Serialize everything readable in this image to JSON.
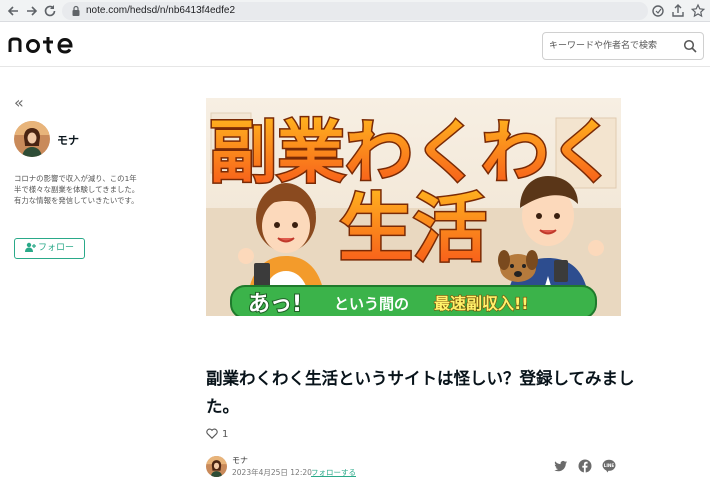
{
  "browser": {
    "url": "note.com/hedsd/n/nb6413f4edfe2",
    "icons": [
      "back-arrow-icon",
      "forward-arrow-icon",
      "reload-icon",
      "lock-icon",
      "cast-icon",
      "share-icon",
      "star-icon"
    ]
  },
  "header": {
    "logo": "note",
    "search_placeholder": "キーワードや作者名で検索"
  },
  "sidebar": {
    "collapse_label": "«",
    "author_name": "モナ",
    "bio": "コロナの影響で収入が減り、この1年半で様々な副業を体験してきました。有力な情報を発信していきたいです。",
    "follow_label": "フォロー"
  },
  "article": {
    "hero": {
      "headline_line1": "副業わくわく",
      "headline_line2": "生活",
      "banner_accent": "あっ!",
      "banner_mid": "という間の",
      "banner_strong": "最速副収入!!"
    },
    "title": "副業わくわく生活というサイトは怪しい？登録してみました。",
    "like_count": "1",
    "byline": {
      "author": "モナ",
      "date": "2023年4月25日 12:20",
      "follow_link": "フォローする"
    },
    "share_icons": [
      "twitter-icon",
      "facebook-icon",
      "line-icon"
    ]
  },
  "colors": {
    "accent": "#2aa989",
    "headline_orange": "#f6661e",
    "banner_green": "#3bb34a"
  }
}
